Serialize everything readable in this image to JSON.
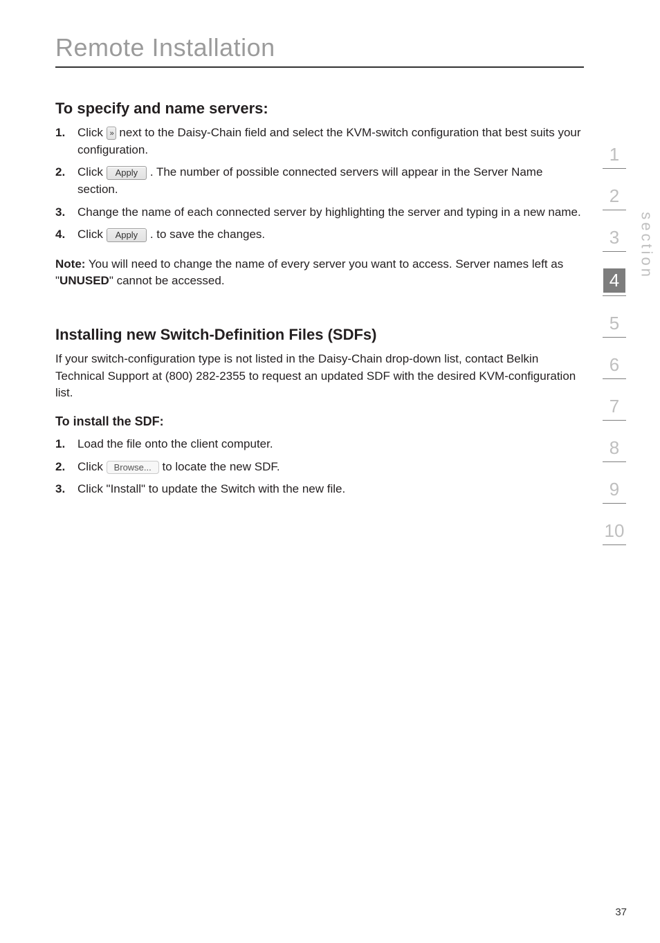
{
  "title": "Remote Installation",
  "section1": {
    "heading": "To specify and name servers:",
    "items": [
      {
        "num": "1.",
        "pre": "Click ",
        "btn": "»",
        "post": " next to the Daisy-Chain field and select the KVM-switch configuration that best suits your configuration."
      },
      {
        "num": "2.",
        "pre": "Click ",
        "btn": "Apply",
        "post": ". The number of possible connected servers will appear in the Server Name section."
      },
      {
        "num": "3.",
        "text": "Change the name of each connected server by highlighting the server and typing in a new name."
      },
      {
        "num": "4.",
        "pre": "Click ",
        "btn": "Apply",
        "post": ". to save the changes."
      }
    ]
  },
  "note": {
    "label": "Note:",
    "text1": " You will need to change the name of every server you want to access. Server names left as \"",
    "bold": "UNUSED",
    "text2": "\" cannot be accessed."
  },
  "section2": {
    "heading": "Installing new Switch-Definition Files (SDFs)",
    "para": "If your switch-configuration type is not listed in the Daisy-Chain drop-down list, contact Belkin Technical Support at (800) 282-2355 to request an updated SDF with the desired KVM-configuration list.",
    "subheading": "To install the SDF:",
    "items": [
      {
        "num": "1.",
        "text": "Load the file onto the client computer."
      },
      {
        "num": "2.",
        "pre": "Click ",
        "btn": "Browse...",
        "post": " to locate the new SDF."
      },
      {
        "num": "3.",
        "text": "Click \"Install\" to update the Switch with the new file."
      }
    ]
  },
  "sidebar": {
    "items": [
      "1",
      "2",
      "3",
      "4",
      "5",
      "6",
      "7",
      "8",
      "9",
      "10"
    ],
    "active": "4",
    "label": "section"
  },
  "pageNumber": "37"
}
